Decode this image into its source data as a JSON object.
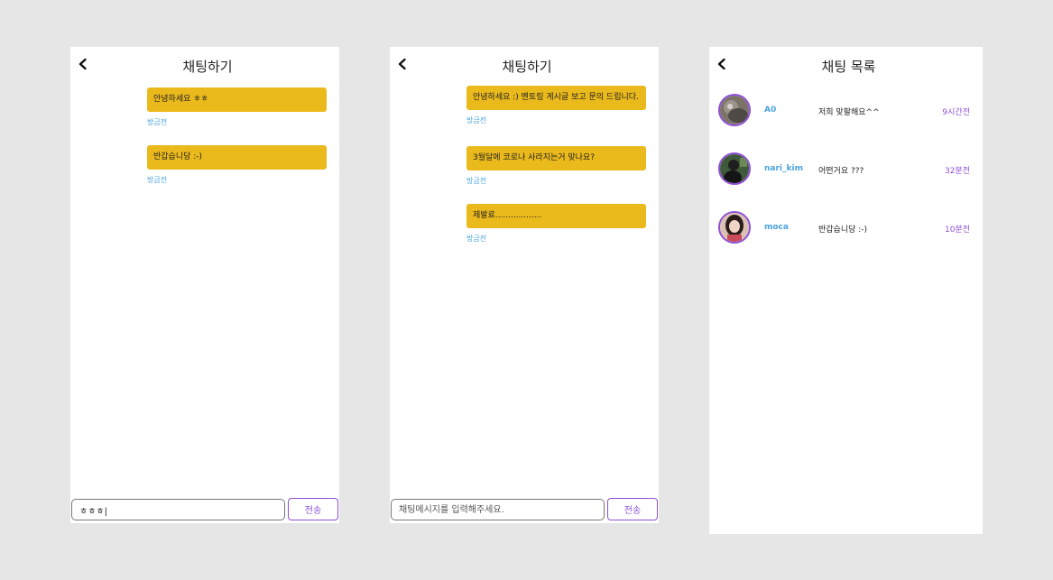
{
  "screen1": {
    "title": "채팅하기",
    "messages": [
      {
        "text": "안녕하세요 ㅎㅎ",
        "time": "방금전"
      },
      {
        "text": "반갑습니당 :-)",
        "time": "방금전"
      }
    ],
    "input_value": "ㅎㅎㅎ|",
    "input_placeholder": "",
    "send_label": "전송"
  },
  "screen2": {
    "title": "채팅하기",
    "messages": [
      {
        "text": "안녕하세요 :) 멘토링 게시글 보고 문의 드립니다.",
        "time": "방금전"
      },
      {
        "text": "3월달에 코로나 사라지는거 맞나요?",
        "time": "방금전"
      },
      {
        "text": "제발료..................",
        "time": "방금전"
      }
    ],
    "input_value": "",
    "input_placeholder": "채팅메시지를 입력해주세요.",
    "send_label": "전송"
  },
  "screen3": {
    "title": "채팅 목록",
    "rooms": [
      {
        "name": "A0",
        "preview": "저희 맞팔해요^^",
        "time": "9시간전"
      },
      {
        "name": "nari_kim",
        "preview": "어떤거요 ???",
        "time": "32분전"
      },
      {
        "name": "moca",
        "preview": "반갑습니당 :-)",
        "time": "10분전"
      }
    ]
  },
  "icons": {
    "back": "chevron-left-icon",
    "avatar": "user-avatar"
  },
  "colors": {
    "bubble": "#eab91c",
    "accent": "#8e4fd6",
    "link": "#4aa3df",
    "background": "#e6e6e6"
  }
}
